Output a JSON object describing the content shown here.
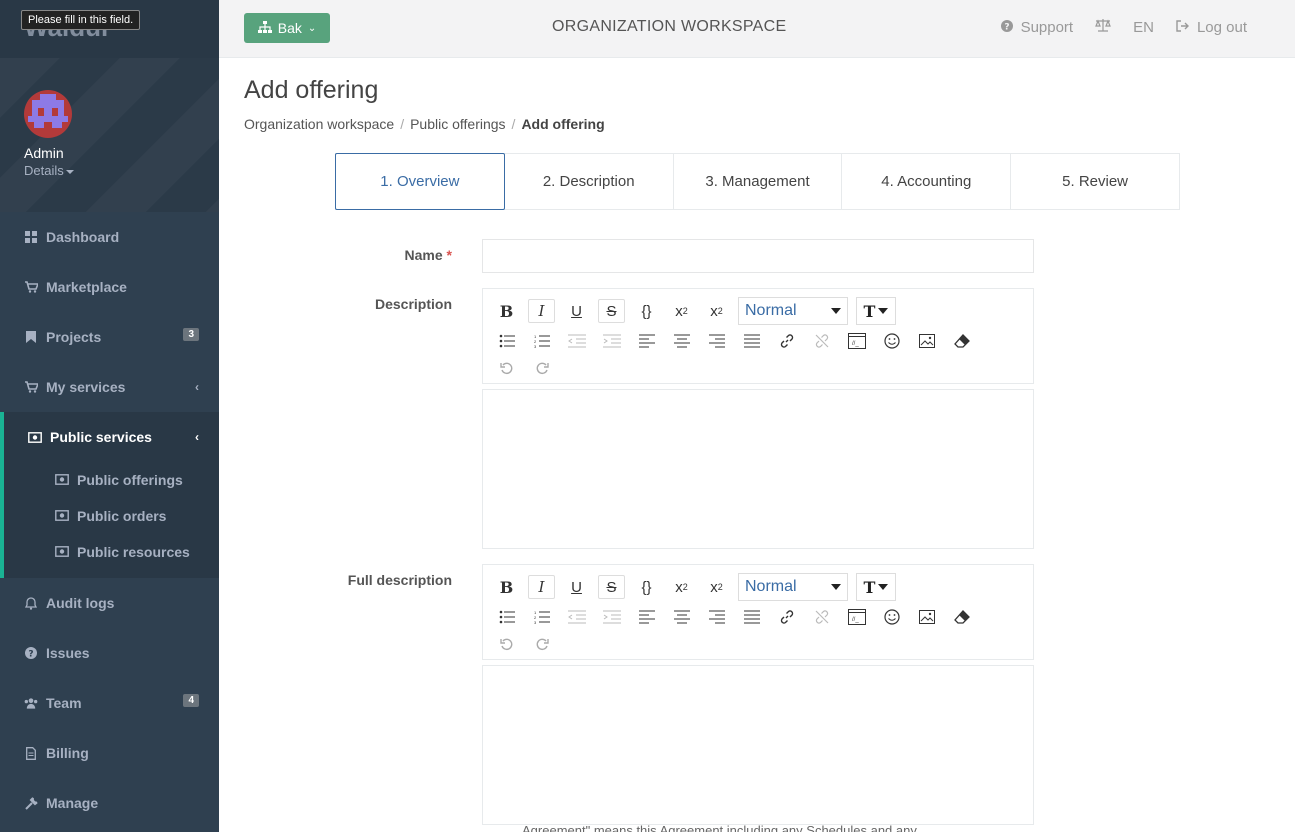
{
  "tooltip": "Please fill in this field.",
  "app": {
    "logo": "Waldur"
  },
  "profile": {
    "name": "Admin",
    "details_label": "Details"
  },
  "sidebar": {
    "items": [
      {
        "label": "Dashboard",
        "icon": "dashboard-icon"
      },
      {
        "label": "Marketplace",
        "icon": "cart-icon"
      },
      {
        "label": "Projects",
        "icon": "bookmark-icon",
        "badge": "3"
      },
      {
        "label": "My services",
        "icon": "cart-icon",
        "chevron": "‹"
      }
    ],
    "active_group": {
      "label": "Public services",
      "chevron": "‹",
      "children": [
        {
          "label": "Public offerings"
        },
        {
          "label": "Public orders"
        },
        {
          "label": "Public resources"
        }
      ]
    },
    "items_after": [
      {
        "label": "Audit logs",
        "icon": "bell-icon"
      },
      {
        "label": "Issues",
        "icon": "question-icon"
      },
      {
        "label": "Team",
        "icon": "users-icon",
        "badge": "4"
      },
      {
        "label": "Billing",
        "icon": "file-icon"
      },
      {
        "label": "Manage",
        "icon": "wrench-icon"
      }
    ]
  },
  "topbar": {
    "project_button": "Bak",
    "title": "ORGANIZATION WORKSPACE",
    "support": "Support",
    "language": "EN",
    "logout": "Log out"
  },
  "page": {
    "title": "Add offering",
    "breadcrumb": [
      "Organization workspace",
      "Public offerings",
      "Add offering"
    ]
  },
  "wizard": {
    "steps": [
      "1. Overview",
      "2. Description",
      "3. Management",
      "4. Accounting",
      "5. Review"
    ],
    "active_index": 0
  },
  "form": {
    "name_label": "Name",
    "required_mark": "*",
    "name_value": "",
    "description_label": "Description",
    "full_description_label": "Full description",
    "format_value": "Normal"
  },
  "footer_text": "Agreement\" means this Agreement including any Schedules and any"
}
